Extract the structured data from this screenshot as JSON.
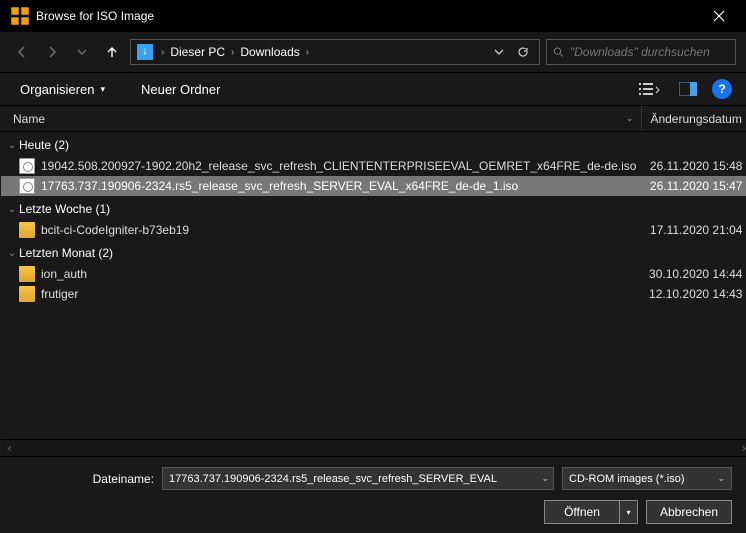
{
  "titlebar": {
    "title": "Browse for ISO Image"
  },
  "breadcrumb": {
    "seg1": "Dieser PC",
    "seg2": "Downloads"
  },
  "search": {
    "placeholder": "\"Downloads\" durchsuchen"
  },
  "toolbar": {
    "organize": "Organisieren",
    "new_folder": "Neuer Ordner"
  },
  "columns": {
    "name": "Name",
    "date": "Änderungsdatum"
  },
  "groups": {
    "today": {
      "label": "Heute (2)"
    },
    "lastweek": {
      "label": "Letzte Woche (1)"
    },
    "lastmonth": {
      "label": "Letzten Monat (2)"
    }
  },
  "files": {
    "f1": {
      "name": "19042.508.200927-1902.20h2_release_svc_refresh_CLIENTENTERPRISEEVAL_OEMRET_x64FRE_de-de.iso",
      "date": "26.11.2020 15:48"
    },
    "f2": {
      "name": "17763.737.190906-2324.rs5_release_svc_refresh_SERVER_EVAL_x64FRE_de-de_1.iso",
      "date": "26.11.2020 15:47"
    },
    "f3": {
      "name": "bcit-ci-CodeIgniter-b73eb19",
      "date": "17.11.2020 21:04"
    },
    "f4": {
      "name": "ion_auth",
      "date": "30.10.2020 14:44"
    },
    "f5": {
      "name": "frutiger",
      "date": "12.10.2020 14:43"
    }
  },
  "footer": {
    "filename_label": "Dateiname:",
    "filename_value": "17763.737.190906-2324.rs5_release_svc_refresh_SERVER_EVAL",
    "filter": "CD-ROM images (*.iso)",
    "open": "Öffnen",
    "cancel": "Abbrechen"
  }
}
